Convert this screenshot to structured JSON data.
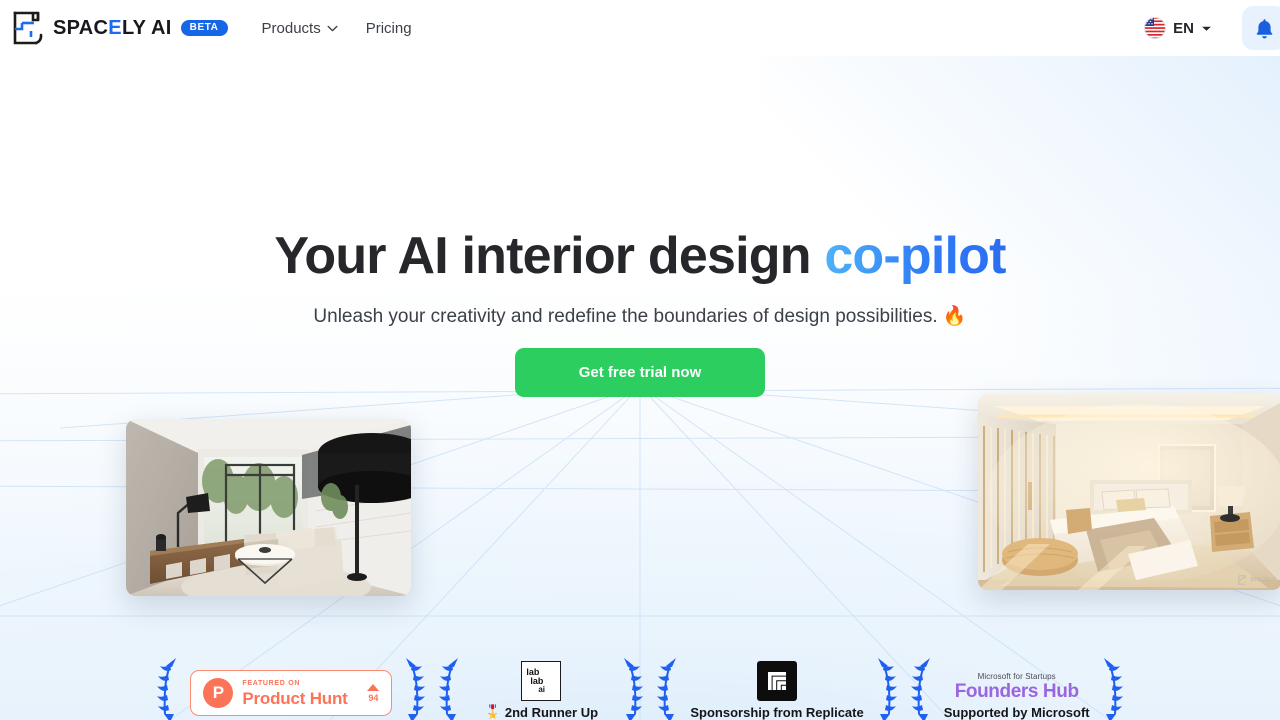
{
  "navbar": {
    "logo": {
      "icon": "spacely-floorplan-logo-icon",
      "word_1": "SPAC",
      "word_hl": "E",
      "word_2": "LY AI",
      "full": "SPACELY AI"
    },
    "beta_label": "BETA",
    "links": [
      {
        "label": "Products",
        "has_dropdown": true,
        "icon": "chevron-down-icon"
      },
      {
        "label": "Pricing",
        "has_dropdown": false
      }
    ],
    "language": {
      "code": "EN",
      "flag": "us-flag-icon",
      "caret": "chevron-down-icon"
    },
    "notification": {
      "icon": "bell-icon"
    }
  },
  "hero": {
    "headline_main": "Your AI interior design ",
    "headline_accent": "co-pilot",
    "subheadline": "Unleash your creativity and redefine the boundaries of design possibilities.",
    "subheadline_emoji": "🔥",
    "cta_label": "Get free trial now",
    "showcase_left": {
      "name": "living-room-render",
      "alt": "Modern living room interior render"
    },
    "showcase_right": {
      "name": "bedroom-render",
      "alt": "Warm lit bedroom interior render",
      "watermark": "SPACELY"
    }
  },
  "awards": [
    {
      "id": "product-hunt",
      "kind": "product_hunt",
      "featured_on": "FEATURED ON",
      "name": "Product Hunt",
      "score": "94",
      "initial": "P"
    },
    {
      "id": "lablab-ai",
      "kind": "lablab",
      "logo_lines": [
        "lab",
        "lab",
        "ai"
      ],
      "caption": "2nd Runner Up",
      "caption_emoji": "🎖️"
    },
    {
      "id": "replicate",
      "kind": "replicate",
      "caption": "Sponsorship from Replicate"
    },
    {
      "id": "microsoft-founders-hub",
      "kind": "microsoft",
      "top_line": "Microsoft for Startups",
      "main_line": "Founders Hub",
      "caption": "Supported by Microsoft"
    }
  ],
  "colors": {
    "brand_blue": "#1667e8",
    "accent_gradient_start": "#4fb3f9",
    "accent_gradient_end": "#2a6df2",
    "cta_green": "#2bce5f",
    "product_hunt_orange": "#fc7458",
    "microsoft_purple": "#9a66e0",
    "laurel_blue": "#1f60f0",
    "hero_bg_bottom": "#e8f2fc"
  }
}
